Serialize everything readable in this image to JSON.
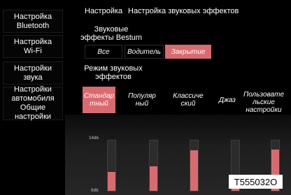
{
  "sidebar": {
    "items": [
      {
        "label": "Настройка\nBluetooth"
      },
      {
        "label": "Настройка\nWi-Fi"
      },
      {
        "label": "Настройки\nзвука"
      },
      {
        "label": "Настройки\nавтомобиля\nОбщие\nнастройки"
      }
    ]
  },
  "breadcrumb": {
    "level1": "Настройка",
    "level2": "Настройка звуковых эффектов"
  },
  "effects": {
    "title": "Звуковые\nэффекты Bestum",
    "options": [
      "Все",
      "Водитель",
      "Закрытие"
    ],
    "selected": "Закрытие"
  },
  "mode": {
    "title": "Режим звуковых\nэффектов",
    "presets": [
      "Стандар\nтный",
      "Популяр\nный",
      "Классиче\nский",
      "Джаз",
      "Пользовате\nльские\nнастройки"
    ],
    "selected": "Стандар\nтный"
  },
  "equalizer": {
    "scale_max": "14db",
    "scale_min": "0db",
    "levels_fraction": [
      0.38,
      0.48,
      0.8,
      0.22,
      0.82
    ]
  },
  "image_code": "T555032O",
  "colors": {
    "accent": "#d96a6f",
    "background": "#000000"
  }
}
